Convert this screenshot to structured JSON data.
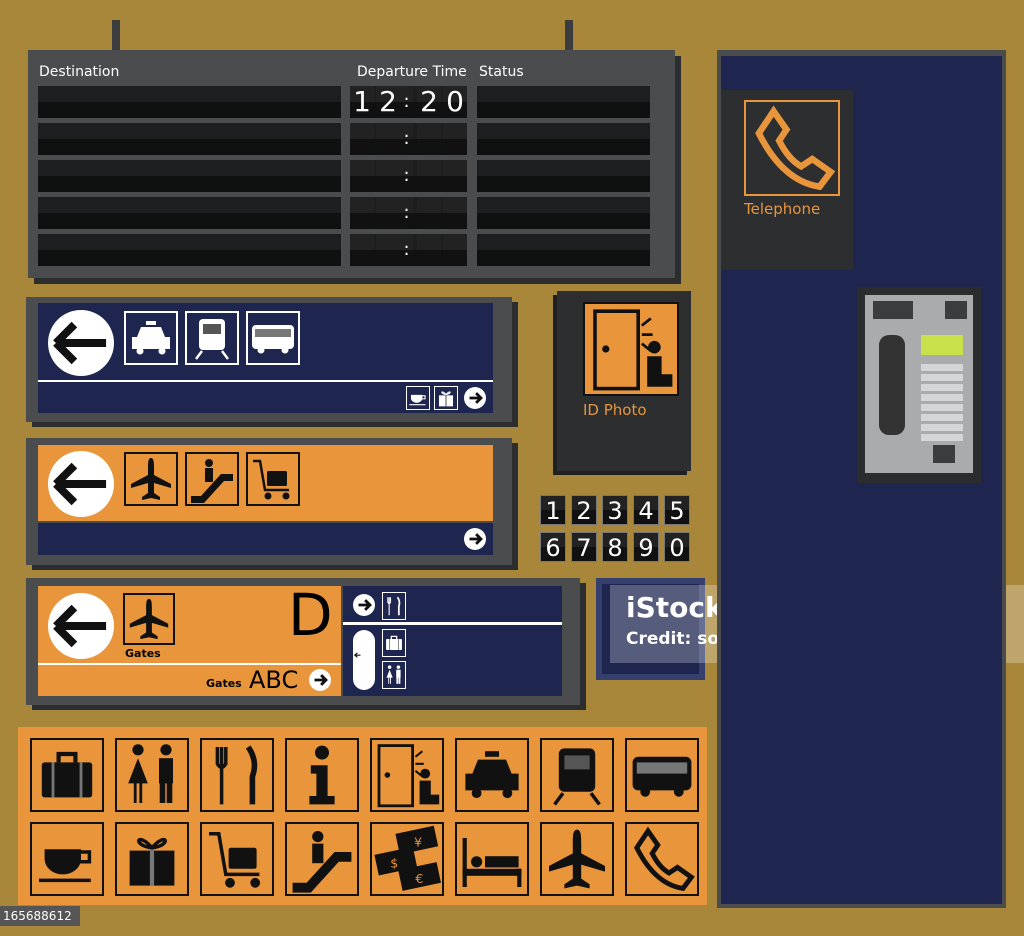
{
  "colors": {
    "background": "#a8873a",
    "orange": "#e8953c",
    "navy": "#1e2650",
    "board": "#4b4c4e"
  },
  "departure_board": {
    "headers": {
      "destination": "Destination",
      "departure_time": "Departure Time",
      "status": "Status"
    },
    "time_digits": [
      "1",
      "2",
      "20"
    ],
    "time": {
      "h1": "1",
      "h2": "2",
      "m1": "2",
      "m2": "0"
    },
    "rows": 5
  },
  "sign_transport": {
    "arrow": "arrow-left-icon",
    "icons": [
      "taxi-icon",
      "train-icon",
      "bus-icon"
    ],
    "small_icons": [
      "coffee-icon",
      "gift-icon",
      "arrow-right-icon"
    ]
  },
  "sign_airport": {
    "arrow": "arrow-left-icon",
    "icons": [
      "plane-icon",
      "escalator-icon",
      "luggage-cart-icon"
    ],
    "small_icons": [
      "arrow-right-icon"
    ]
  },
  "sign_gates": {
    "gates_label": "Gates",
    "gate_letter": "D",
    "gates_abc_label": "Gates",
    "gates_abc": "ABC",
    "right_icons": [
      "restaurant-icon",
      "luggage-icon",
      "restroom-icon"
    ]
  },
  "id_photo": {
    "label": "ID Photo"
  },
  "telephone": {
    "label": "Telephone"
  },
  "digits": [
    "1",
    "2",
    "3",
    "4",
    "5",
    "6",
    "7",
    "8",
    "9",
    "0"
  ],
  "watermark": {
    "brand": "iStock",
    "credit": "Credit: sorbetto"
  },
  "image_id": "165688612",
  "icon_grid": [
    "luggage-icon",
    "restroom-icon",
    "restaurant-icon",
    "info-icon",
    "id-photo-icon",
    "taxi-icon",
    "train-icon",
    "bus-icon",
    "coffee-icon",
    "gift-icon",
    "luggage-cart-icon",
    "escalator-icon",
    "currency-exchange-icon",
    "hotel-icon",
    "plane-icon",
    "telephone-icon"
  ]
}
